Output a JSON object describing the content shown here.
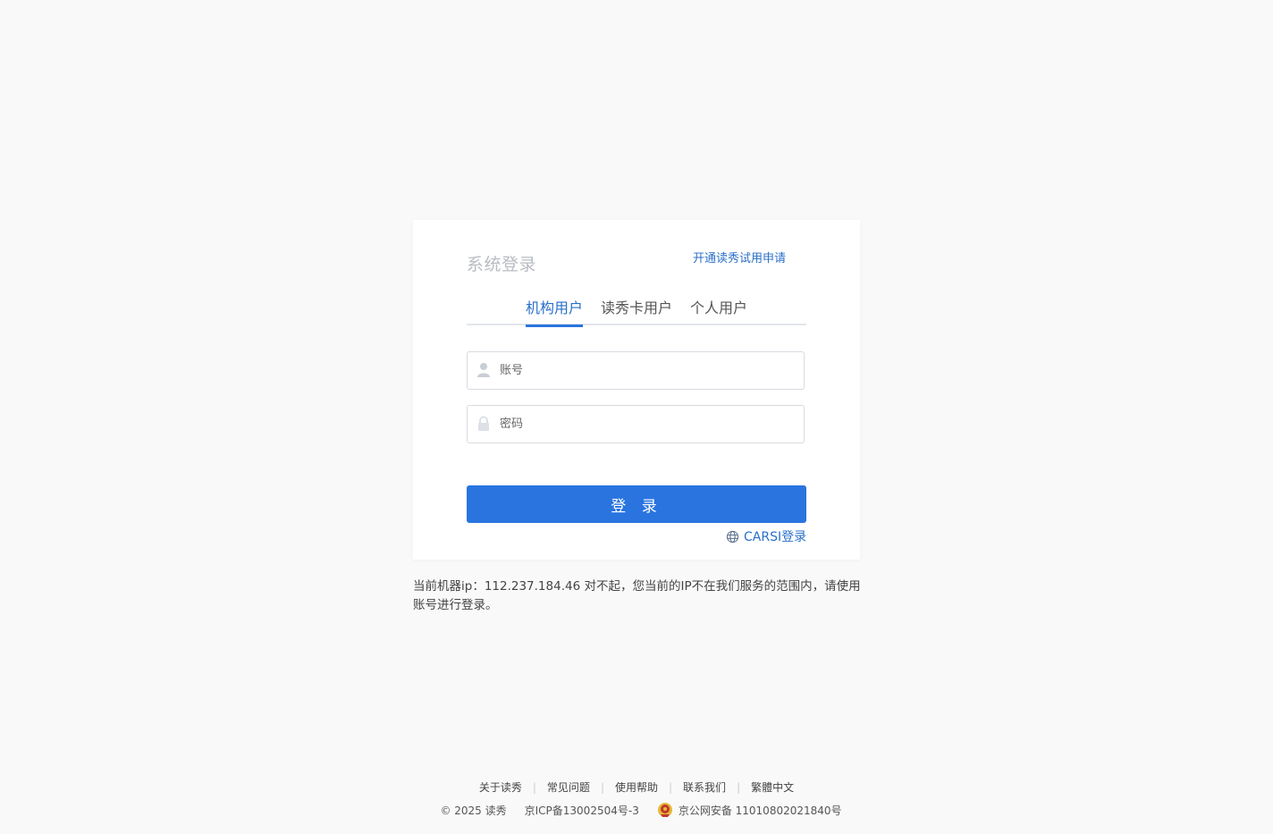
{
  "login": {
    "title": "系统登录",
    "trial_link": "开通读秀试用申请",
    "tabs": [
      {
        "label": "机构用户",
        "active": true
      },
      {
        "label": "读秀卡用户",
        "active": false
      },
      {
        "label": "个人用户",
        "active": false
      }
    ],
    "account_placeholder": "账号",
    "password_placeholder": "密码",
    "submit_label": "登 录",
    "carsi_label": "CARSI登录",
    "accent_color": "#2a74e0"
  },
  "notice": {
    "text": "当前机器ip：112.237.184.46  对不起，您当前的IP不在我们服务的范围内，请使用账号进行登录。"
  },
  "footer": {
    "links": [
      "关于读秀",
      "常见问题",
      "使用帮助",
      "联系我们",
      "繁體中文"
    ],
    "separator": "|",
    "copyright": "© 2025 读秀",
    "icp": "京ICP备13002504号-3",
    "police_record": "京公网安备 11010802021840号"
  }
}
